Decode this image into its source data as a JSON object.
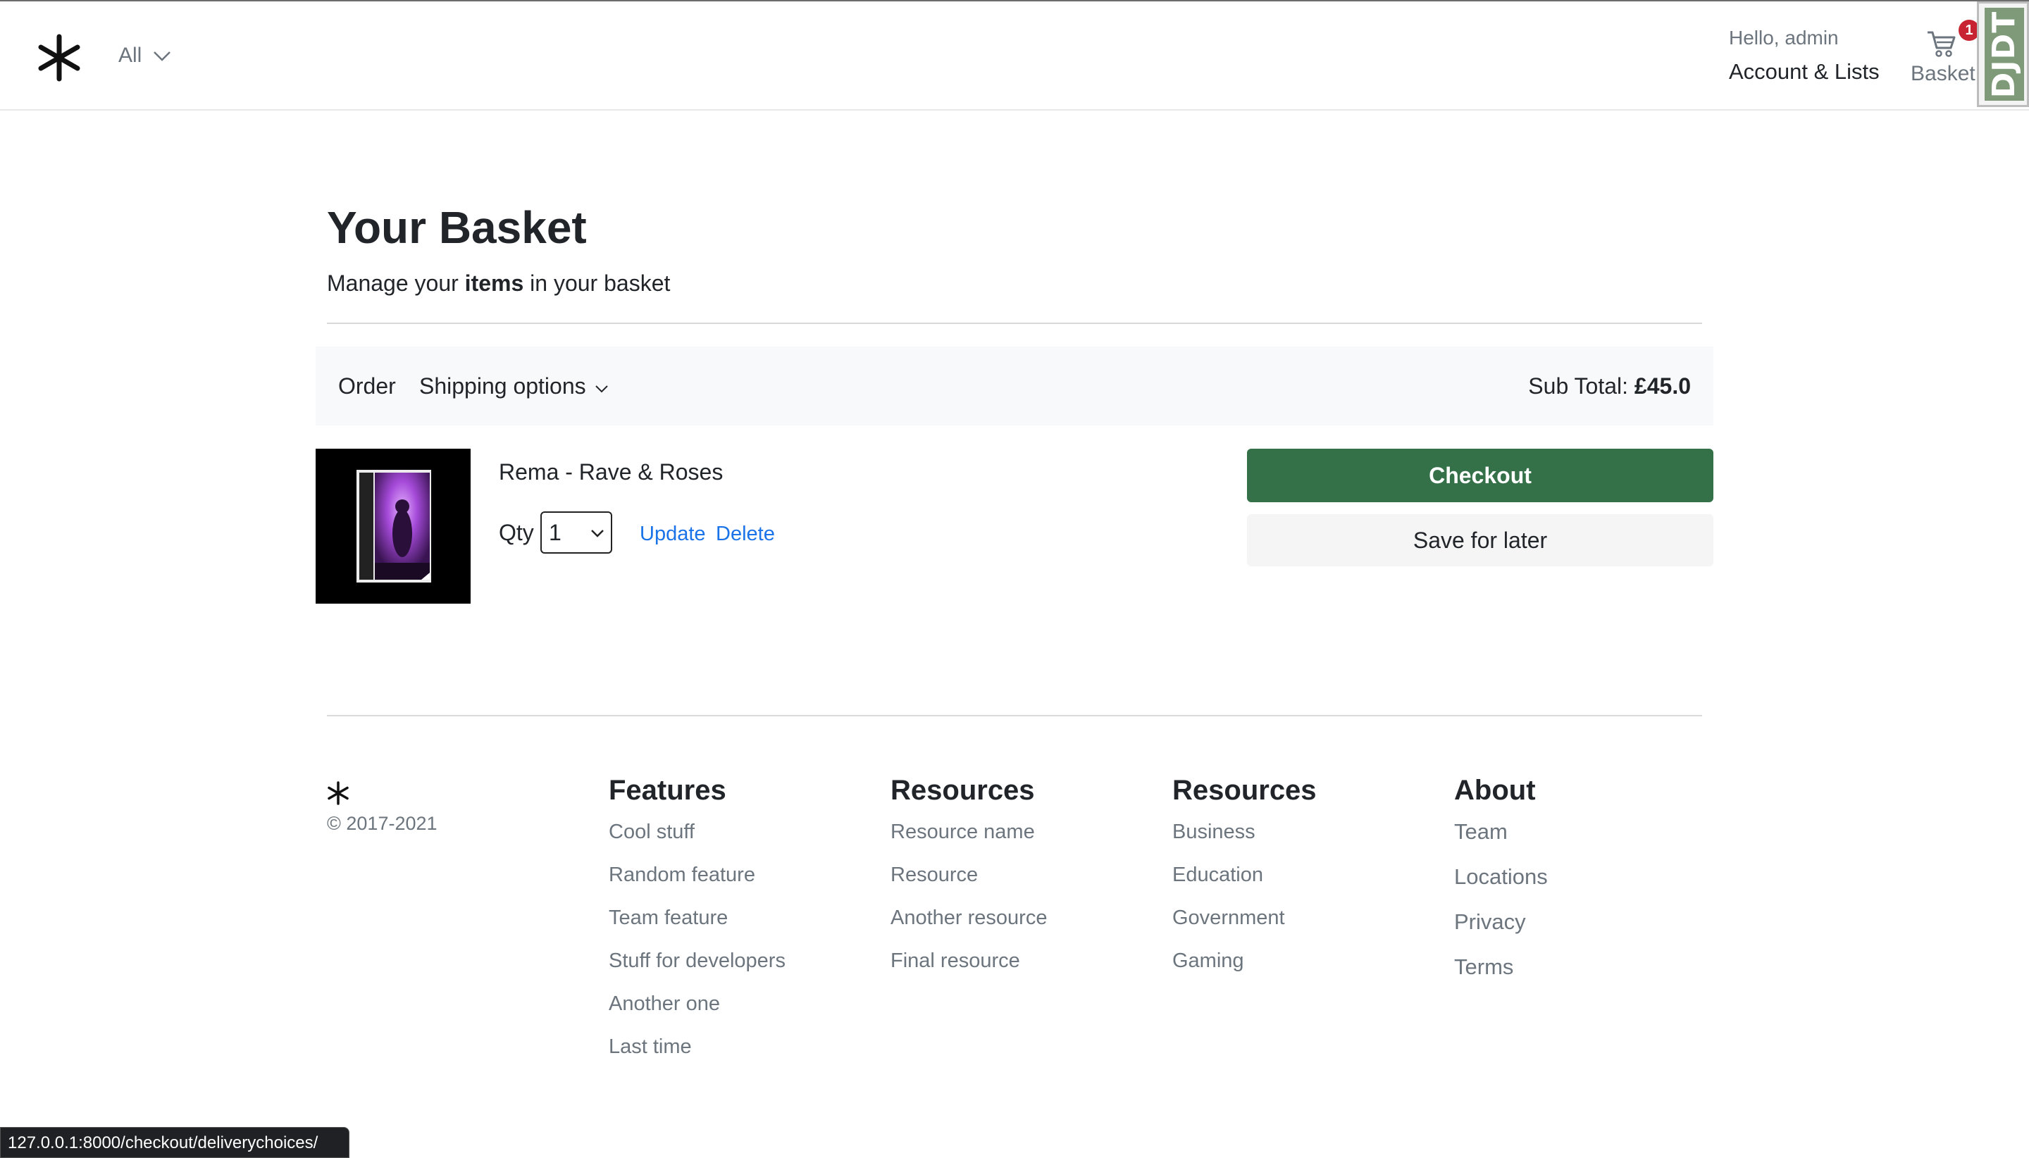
{
  "header": {
    "logo_name": "asterisk-logo",
    "category_dropdown": "All",
    "account_greeting": "Hello, admin",
    "account_link": "Account & Lists",
    "basket_label": "Basket",
    "basket_count": "1",
    "debug_toolbar_label": "DJDT"
  },
  "page": {
    "title": "Your Basket",
    "subtitle_prefix": "Manage your ",
    "subtitle_bold": "items",
    "subtitle_suffix": " in your basket"
  },
  "orderbar": {
    "order_label": "Order",
    "shipping_label": "Shipping options",
    "subtotal_label": "Sub Total: ",
    "subtotal_value": "£45.0"
  },
  "items": [
    {
      "name": "Rema - Rave & Roses",
      "qty_label": "Qty",
      "qty_value": "1",
      "update_label": "Update",
      "delete_label": "Delete"
    }
  ],
  "actions": {
    "checkout_label": "Checkout",
    "save_label": "Save for later"
  },
  "footer": {
    "copyright": "© 2017-2021",
    "columns": [
      {
        "heading": "Features",
        "links": [
          "Cool stuff",
          "Random feature",
          "Team feature",
          "Stuff for developers",
          "Another one",
          "Last time"
        ]
      },
      {
        "heading": "Resources",
        "links": [
          "Resource name",
          "Resource",
          "Another resource",
          "Final resource"
        ]
      },
      {
        "heading": "Resources",
        "links": [
          "Business",
          "Education",
          "Government",
          "Gaming"
        ]
      },
      {
        "heading": "About",
        "links": [
          "Team",
          "Locations",
          "Privacy",
          "Terms"
        ]
      }
    ]
  },
  "status_url": "127.0.0.1:8000/checkout/deliverychoices/",
  "colors": {
    "checkout_green": "#347148",
    "link_blue": "#1a73e8",
    "badge_red": "#c82333",
    "toolbar_green": "#7e9a79"
  }
}
